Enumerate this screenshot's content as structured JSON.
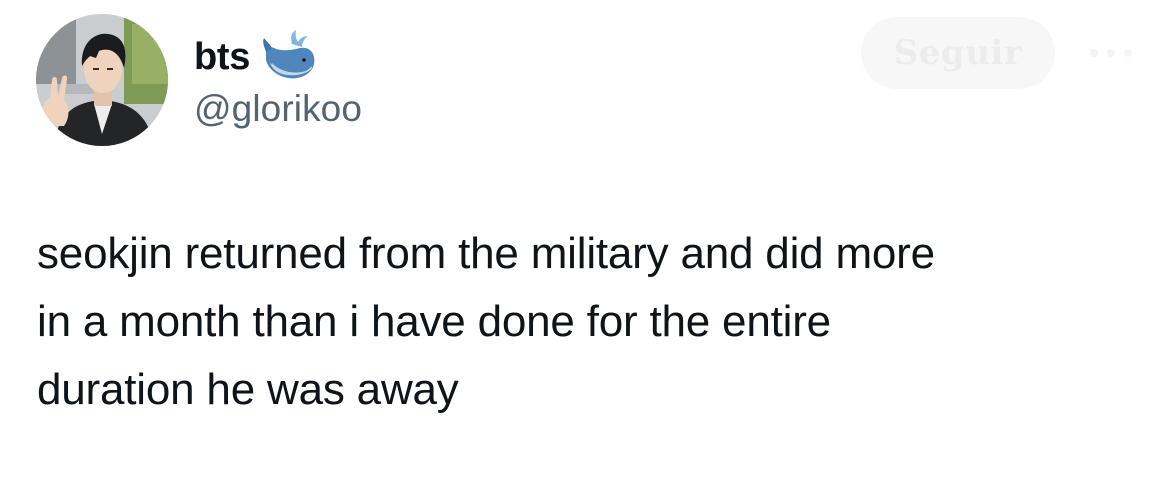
{
  "author": {
    "display_name": "bts",
    "handle": "@glorikoo",
    "name_emoji": "whale-emoji",
    "avatar": "profile-photo"
  },
  "actions": {
    "follow_label": "Seguir",
    "more_icon": "more-dots-icon"
  },
  "tweet": {
    "lines": [
      "seokjin returned from the military and did more",
      "in a month than i have done for the entire",
      "duration he was away"
    ]
  },
  "colors": {
    "text": "#0f1419",
    "handle": "#536471",
    "follow_bg": "#f7f7f7",
    "follow_text": "#ececec",
    "background": "#ffffff"
  }
}
